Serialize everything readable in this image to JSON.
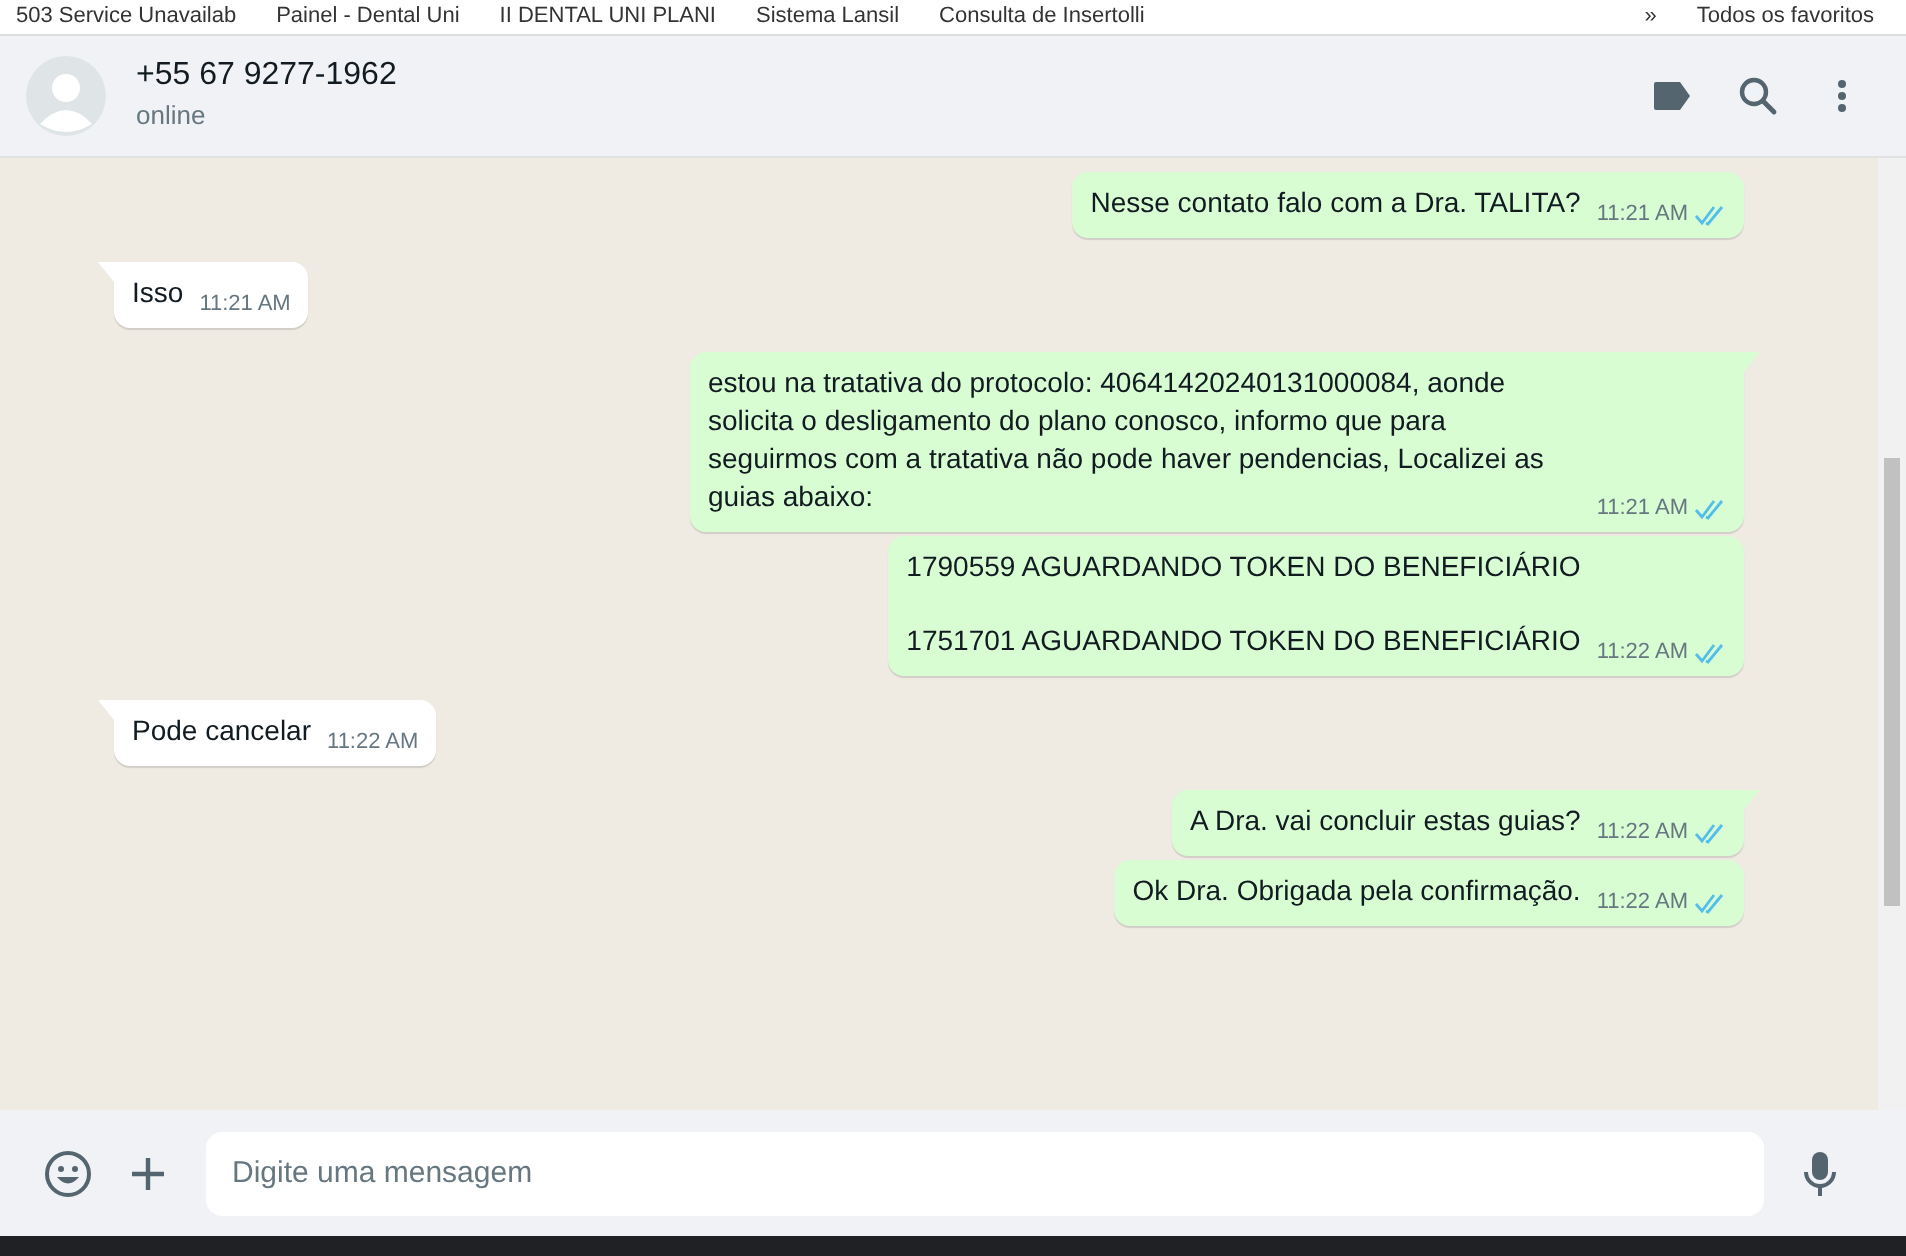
{
  "bookmarks": [
    "503 Service Unavailab",
    "Painel - Dental Uni",
    "II DENTAL UNI PLANI",
    "Sistema Lansil",
    "Consulta de Insertolli"
  ],
  "bookmarks_more": "»",
  "all_bookmarks": "Todos os favoritos",
  "contact": {
    "name": "+55 67 9277-1962",
    "status": "online"
  },
  "messages": [
    {
      "kind": "sent",
      "tail": false,
      "paragraphs": [
        "Nesse contato falo com a Dra. TALITA?"
      ],
      "time": "11:21 AM",
      "read": true
    },
    {
      "kind": "received",
      "tail": true,
      "paragraphs": [
        "Isso"
      ],
      "time": "11:21 AM",
      "read": false
    },
    {
      "kind": "sent",
      "tail": true,
      "paragraphs": [
        "estou na tratativa do protocolo: 40641420240131000084, aonde solicita o desligamento do plano conosco, informo que para seguirmos com a tratativa não pode haver pendencias, Localizei as guias abaixo:"
      ],
      "time": "11:21 AM",
      "read": true
    },
    {
      "kind": "sent",
      "tail": false,
      "paragraphs": [
        "1790559 AGUARDANDO TOKEN DO BENEFICIÁRIO",
        "1751701 AGUARDANDO TOKEN DO BENEFICIÁRIO"
      ],
      "time": "11:22 AM",
      "read": true
    },
    {
      "kind": "received",
      "tail": true,
      "paragraphs": [
        "Pode cancelar"
      ],
      "time": "11:22 AM",
      "read": false
    },
    {
      "kind": "sent",
      "tail": true,
      "paragraphs": [
        "A Dra. vai concluir estas guias?"
      ],
      "time": "11:22 AM",
      "read": true
    },
    {
      "kind": "sent",
      "tail": false,
      "paragraphs": [
        "Ok Dra. Obrigada pela confirmação."
      ],
      "time": "11:22 AM",
      "read": true
    }
  ],
  "composer": {
    "placeholder": "Digite uma mensagem"
  }
}
